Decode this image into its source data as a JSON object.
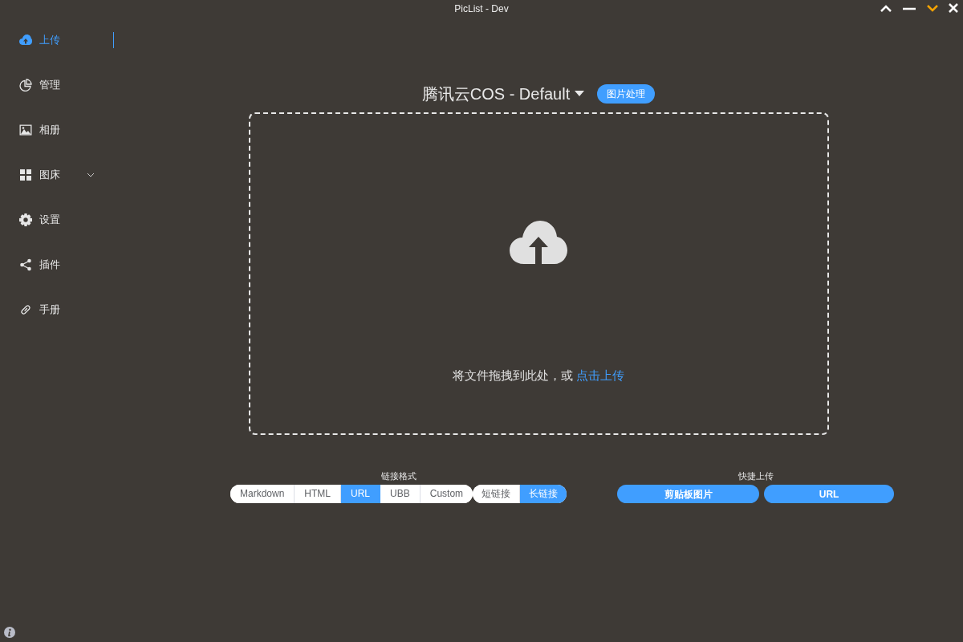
{
  "window": {
    "title": "PicList - Dev"
  },
  "sidebar": {
    "items": [
      {
        "label": "上传",
        "selected": true
      },
      {
        "label": "管理",
        "selected": false
      },
      {
        "label": "相册",
        "selected": false
      },
      {
        "label": "图床",
        "selected": false,
        "expanded": false
      },
      {
        "label": "设置",
        "selected": false
      },
      {
        "label": "插件",
        "selected": false
      },
      {
        "label": "手册",
        "selected": false
      }
    ]
  },
  "uploader": {
    "title": "腾讯云COS - Default",
    "badge": "图片处理",
    "hint": "将文件拖拽到此处，或",
    "link": "点击上传"
  },
  "link_format": {
    "label": "链接格式",
    "options": [
      {
        "label": "Markdown",
        "selected": false
      },
      {
        "label": "HTML",
        "selected": false
      },
      {
        "label": "URL",
        "selected": true
      },
      {
        "label": "UBB",
        "selected": false
      },
      {
        "label": "Custom",
        "selected": false
      }
    ],
    "length": [
      {
        "label": "短链接",
        "selected": false
      },
      {
        "label": "长链接",
        "selected": true
      }
    ]
  },
  "quick_upload": {
    "label": "快捷上传",
    "buttons": [
      "剪贴板图片",
      "URL"
    ]
  }
}
